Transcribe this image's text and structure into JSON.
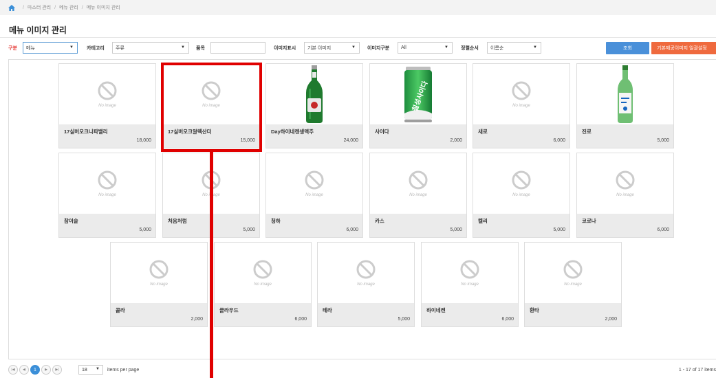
{
  "breadcrumb": [
    "마스터 관리",
    "메뉴 관리",
    "메뉴 이미지 관리"
  ],
  "page_title": "메뉴 이미지 관리",
  "filters": {
    "gubun_label": "구분",
    "gubun_value": "메뉴",
    "category_label": "카테고리",
    "category_value": "주류",
    "item_label": "품목",
    "item_value": "",
    "image_display_label": "이미지표시",
    "image_display_value": "기본 이미지",
    "image_type_label": "이미지구분",
    "image_type_value": "All",
    "sort_label": "정렬순서",
    "sort_value": "이름순"
  },
  "buttons": {
    "search": "조회",
    "batch": "기본제공이미지 일괄설정"
  },
  "no_image_text": "No image",
  "cards": [
    {
      "name": "17실버오크나파밸리",
      "price": "18,000",
      "image": "none"
    },
    {
      "name": "17실버오크알렉산더",
      "price": "15,000",
      "image": "none"
    },
    {
      "name": "Day하이네켄생맥주",
      "price": "24,000",
      "image": "beer-bottle"
    },
    {
      "name": "사이다",
      "price": "2,000",
      "image": "soda-can"
    },
    {
      "name": "새로",
      "price": "6,000",
      "image": "none"
    },
    {
      "name": "진로",
      "price": "5,000",
      "image": "soju-bottle"
    },
    {
      "name": "참이슬",
      "price": "5,000",
      "image": "none"
    },
    {
      "name": "처음처럼",
      "price": "5,000",
      "image": "none"
    },
    {
      "name": "청하",
      "price": "6,000",
      "image": "none"
    },
    {
      "name": "카스",
      "price": "5,000",
      "image": "none"
    },
    {
      "name": "켈리",
      "price": "5,000",
      "image": "none"
    },
    {
      "name": "코로나",
      "price": "6,000",
      "image": "none"
    },
    {
      "name": "콜라",
      "price": "2,000",
      "image": "none"
    },
    {
      "name": "클라우드",
      "price": "6,000",
      "image": "none"
    },
    {
      "name": "테라",
      "price": "5,000",
      "image": "none"
    },
    {
      "name": "하이네켄",
      "price": "6,000",
      "image": "none"
    },
    {
      "name": "환타",
      "price": "2,000",
      "image": "none"
    }
  ],
  "can_label": "칠성사이다",
  "pager": {
    "current_page": "1",
    "page_size": "18",
    "per_page_label": "items per page",
    "info": "1 - 17 of 17 items"
  },
  "colors": {
    "accent_blue": "#4a90d9",
    "accent_orange": "#ef6a3e",
    "highlight_red": "#e00000"
  }
}
